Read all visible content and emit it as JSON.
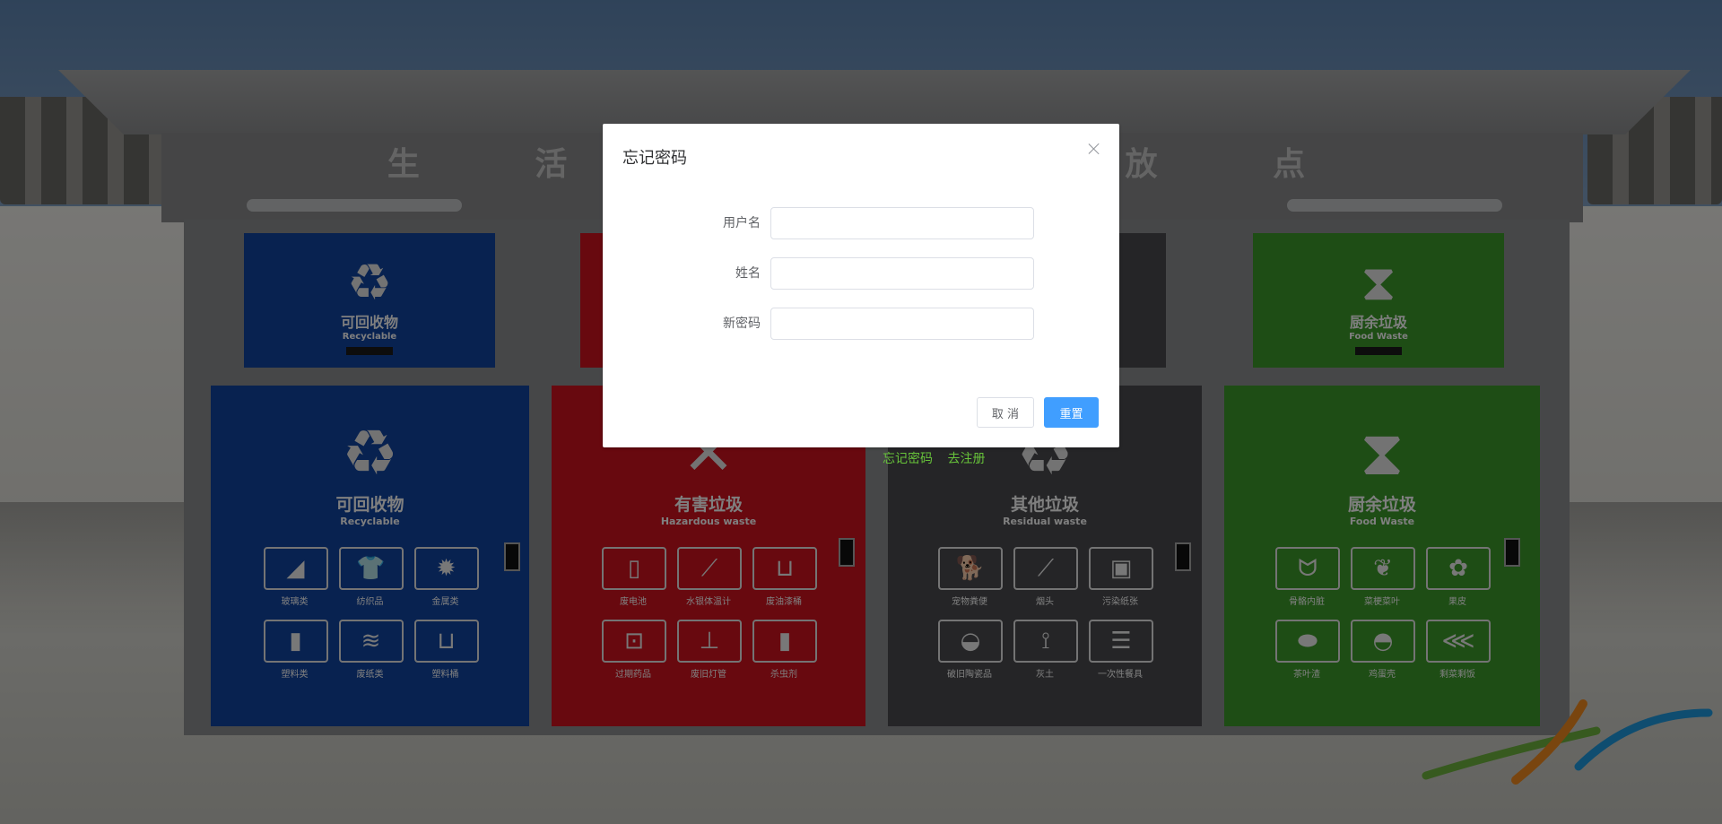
{
  "background": {
    "station_title": "生  活  垃  圾  投  放  点",
    "bins": [
      {
        "name": "可回收物",
        "en": "Recyclable",
        "color": "#1144a0",
        "symbol": "recycle-icon",
        "items": [
          "玻璃类",
          "纺织品",
          "金属类",
          "塑料类",
          "废纸类",
          "塑料桶"
        ]
      },
      {
        "name": "有害垃圾",
        "en": "Hazardous waste",
        "color": "#d1121f",
        "symbol": "hazard-icon",
        "items": [
          "废电池",
          "水银体温计",
          "废油漆桶",
          "过期药品",
          "废旧灯管",
          "杀虫剂"
        ]
      },
      {
        "name": "其他垃圾",
        "en": "Residual waste",
        "color": "#4a4b4e",
        "symbol": "recycle-icon",
        "items": [
          "宠物粪便",
          "烟头",
          "污染纸张",
          "破旧陶瓷品",
          "灰土",
          "一次性餐具"
        ]
      },
      {
        "name": "厨余垃圾",
        "en": "Food Waste",
        "color": "#3c9a2a",
        "symbol": "hourglass-icon",
        "items": [
          "骨骼内脏",
          "菜梗菜叶",
          "果皮",
          "茶叶渣",
          "鸡蛋壳",
          "剩菜剩饭"
        ]
      }
    ]
  },
  "behind_links": {
    "forgot_password": "忘记密码",
    "register": "去注册"
  },
  "dialog": {
    "title": "忘记密码",
    "fields": [
      {
        "label": "用户名",
        "value": "",
        "placeholder": ""
      },
      {
        "label": "姓名",
        "value": "",
        "placeholder": ""
      },
      {
        "label": "新密码",
        "value": "",
        "placeholder": ""
      }
    ],
    "cancel_label": "取 消",
    "reset_label": "重置"
  },
  "colors": {
    "primary": "#409eff",
    "link_green": "#67c23a"
  }
}
